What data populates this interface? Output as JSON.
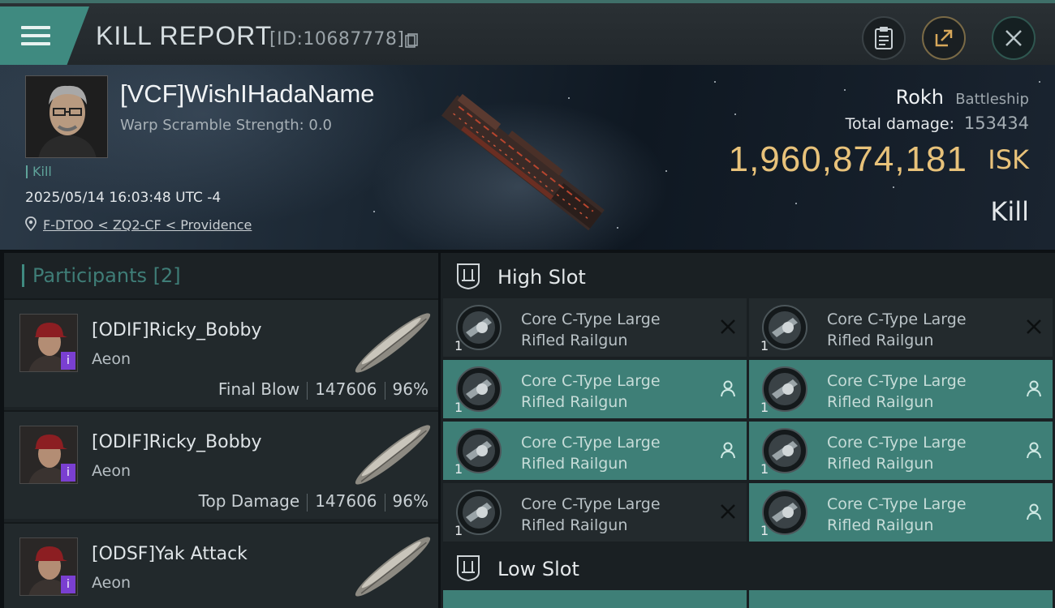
{
  "header": {
    "title": "KILL REPORT",
    "report_id": "[ID:10687778]"
  },
  "victim": {
    "name": "[VCF]WishIHadaName",
    "warp_scramble": "Warp Scramble Strength: 0.0",
    "tag": "Kill",
    "datetime": "2025/05/14 16:03:48 UTC -4",
    "location": "F-DTOO < ZQ2-CF < Providence",
    "ship_name": "Rokh",
    "ship_class": "Battleship",
    "total_damage_label": "Total damage:",
    "total_damage": "153434",
    "isk_value": "1,960,874,181",
    "isk_unit": "ISK",
    "result": "Kill"
  },
  "participants": {
    "header": "Participants [2]",
    "rows": [
      {
        "name": "[ODIF]Ricky_Bobby",
        "ship": "Aeon",
        "role": "Final Blow",
        "damage": "147606",
        "percent": "96%"
      },
      {
        "name": "[ODIF]Ricky_Bobby",
        "ship": "Aeon",
        "role": "Top Damage",
        "damage": "147606",
        "percent": "96%"
      },
      {
        "name": "[ODSF]Yak Attack",
        "ship": "Aeon"
      }
    ]
  },
  "high_slot": {
    "title": "High Slot",
    "modules": [
      {
        "line1": "Core C-Type Large",
        "line2": "Rifled Railgun",
        "qty": "1",
        "status": "destroyed"
      },
      {
        "line1": "Core C-Type Large",
        "line2": "Rifled Railgun",
        "qty": "1",
        "status": "destroyed"
      },
      {
        "line1": "Core C-Type Large",
        "line2": "Rifled Railgun",
        "qty": "1",
        "status": "dropped"
      },
      {
        "line1": "Core C-Type Large",
        "line2": "Rifled Railgun",
        "qty": "1",
        "status": "dropped"
      },
      {
        "line1": "Core C-Type Large",
        "line2": "Rifled Railgun",
        "qty": "1",
        "status": "dropped"
      },
      {
        "line1": "Core C-Type Large",
        "line2": "Rifled Railgun",
        "qty": "1",
        "status": "dropped"
      },
      {
        "line1": "Core C-Type Large",
        "line2": "Rifled Railgun",
        "qty": "1",
        "status": "destroyed"
      },
      {
        "line1": "Core C-Type Large",
        "line2": "Rifled Railgun",
        "qty": "1",
        "status": "dropped"
      }
    ]
  },
  "low_slot": {
    "title": "Low Slot"
  },
  "colors": {
    "accent_teal": "#3f8a80",
    "isk_gold": "#e8c27a",
    "fitted_bg": "#3e7f77"
  },
  "icons": [
    "menu-icon",
    "copy-icon",
    "clipboard-icon",
    "share-icon",
    "close-icon",
    "location-pin-icon",
    "slot-icon",
    "railgun-icon",
    "destroyed-x-icon",
    "pilot-icon"
  ]
}
